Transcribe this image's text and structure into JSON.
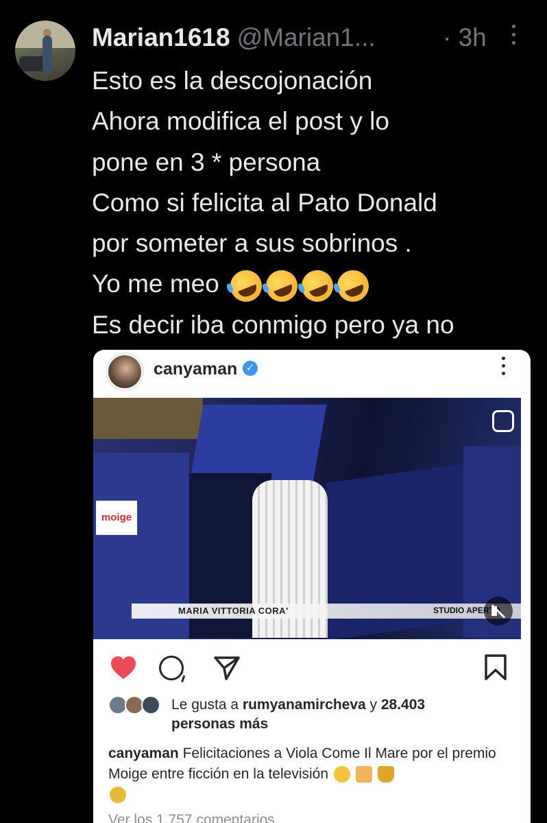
{
  "tweet": {
    "display_name": "Marian1618",
    "handle": "@Marian1...",
    "time": "· 3h",
    "lines": [
      "Esto es la descojonación",
      "Ahora modifica el post y lo",
      "pone en 3 * persona",
      "Como si felicita al Pato Donald",
      "por someter a sus sobrinos .",
      "Yo me meo",
      "Es decir iba conmigo pero ya no"
    ],
    "emoji_name": "rolling-on-the-floor-laughing",
    "emoji_count": 4
  },
  "instagram": {
    "username": "canyaman",
    "verified": true,
    "video": {
      "logo_text": "moige",
      "lower_third_name": "MARIA VITTORIA CORA'",
      "channel_text": "STUDIO APERTO",
      "muted": true
    },
    "liked": true,
    "likes_prefix": "Le gusta a ",
    "likes_user": "rumyanamircheva",
    "likes_mid": " y ",
    "likes_count": "28.403",
    "likes_suffix": "personas más",
    "caption_user": "canyaman",
    "caption_text": " Felicitaciones a Viola Come Il Mare por el premio Moige entre ficción en la televisión",
    "comments_link": "Ver los 1.757 comentarios"
  },
  "colors": {
    "background": "#000000",
    "text": "#e7e9ea",
    "muted_text": "#71767b",
    "like_red": "#ed4956",
    "verified_blue": "#3897f0"
  }
}
